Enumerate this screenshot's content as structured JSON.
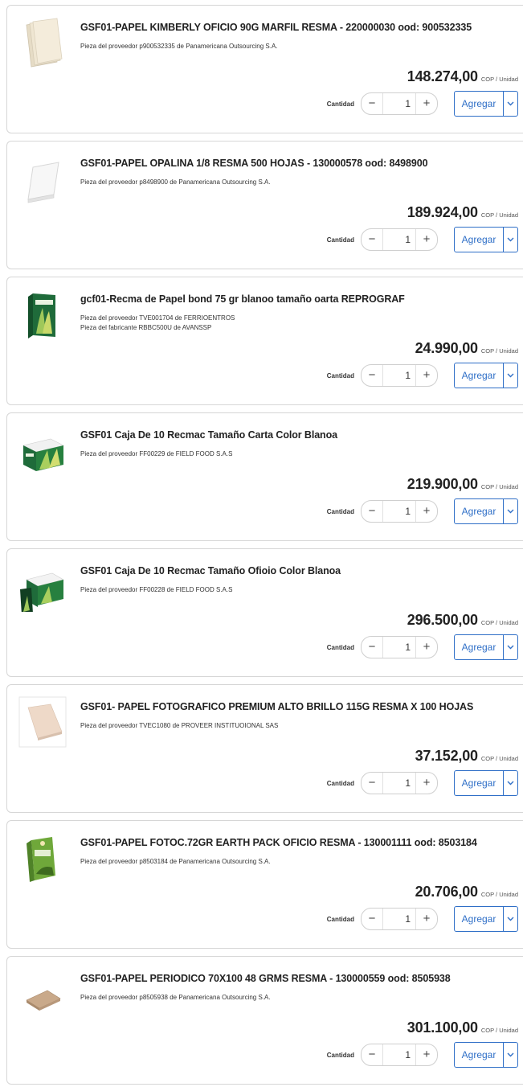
{
  "quantity_label": "Cantidad",
  "unit_label": "COP / Unidad",
  "add_label": "Agregar",
  "accent_color": "#2f6fc7",
  "products": [
    {
      "title": "GSF01-PAPEL KIMBERLY OFICIO 90G MARFIL RESMA - 220000030 ood: 900532335",
      "supplier": "Pieza del proveedor p900532335 de Panamericana Outsourcing S.A.",
      "manufacturer": "",
      "price": "148.274,00",
      "quantity": "1",
      "image": "ivory-paper-sheets-icon"
    },
    {
      "title": "GSF01-PAPEL OPALINA 1/8 RESMA 500 HOJAS - 130000578 ood: 8498900",
      "supplier": "Pieza del proveedor p8498900 de Panamericana Outsourcing S.A.",
      "manufacturer": "",
      "price": "189.924,00",
      "quantity": "1",
      "image": "white-paper-ream-icon"
    },
    {
      "title": "gcf01-Recma de Papel bond 75 gr blanoo tamaño oarta REPROGRAF",
      "supplier": "Pieza del proveedor TVE001704 de FERRIOENTROS",
      "manufacturer": "Pieza del fabricante RBBC500U de AVANSSP",
      "price": "24.990,00",
      "quantity": "1",
      "image": "green-paper-ream-icon"
    },
    {
      "title": "GSF01 Caja De 10 Recmac Tamaño Carta Color Blanoa",
      "supplier": "Pieza del proveedor FF00229 de FIELD FOOD S.A.S",
      "manufacturer": "",
      "price": "219.900,00",
      "quantity": "1",
      "image": "green-paper-box-icon"
    },
    {
      "title": "GSF01 Caja De 10 Recmac Tamaño Ofioio Color Blanoa",
      "supplier": "Pieza del proveedor FF00228 de FIELD FOOD S.A.S",
      "manufacturer": "",
      "price": "296.500,00",
      "quantity": "1",
      "image": "green-paper-box-open-icon"
    },
    {
      "title": "GSF01- PAPEL FOTOGRAFICO PREMIUM ALTO BRILLO 115G RESMA X 100 HOJAS",
      "supplier": "Pieza del proveedor TVEC1080 de PROVEER INSTITUOIONAL SAS",
      "manufacturer": "",
      "price": "37.152,00",
      "quantity": "1",
      "image": "photo-paper-sheet-icon"
    },
    {
      "title": "GSF01-PAPEL FOTOC.72GR EARTH PACK OFICIO RESMA - 130001111 ood: 8503184",
      "supplier": "Pieza del proveedor p8503184 de Panamericana Outsourcing S.A.",
      "manufacturer": "",
      "price": "20.706,00",
      "quantity": "1",
      "image": "earth-pack-ream-icon"
    },
    {
      "title": "GSF01-PAPEL PERIODICO 70X100 48 GRMS RESMA - 130000559 ood: 8505938",
      "supplier": "Pieza del proveedor p8505938 de Panamericana Outsourcing S.A.",
      "manufacturer": "",
      "price": "301.100,00",
      "quantity": "1",
      "image": "newsprint-paper-icon"
    }
  ]
}
